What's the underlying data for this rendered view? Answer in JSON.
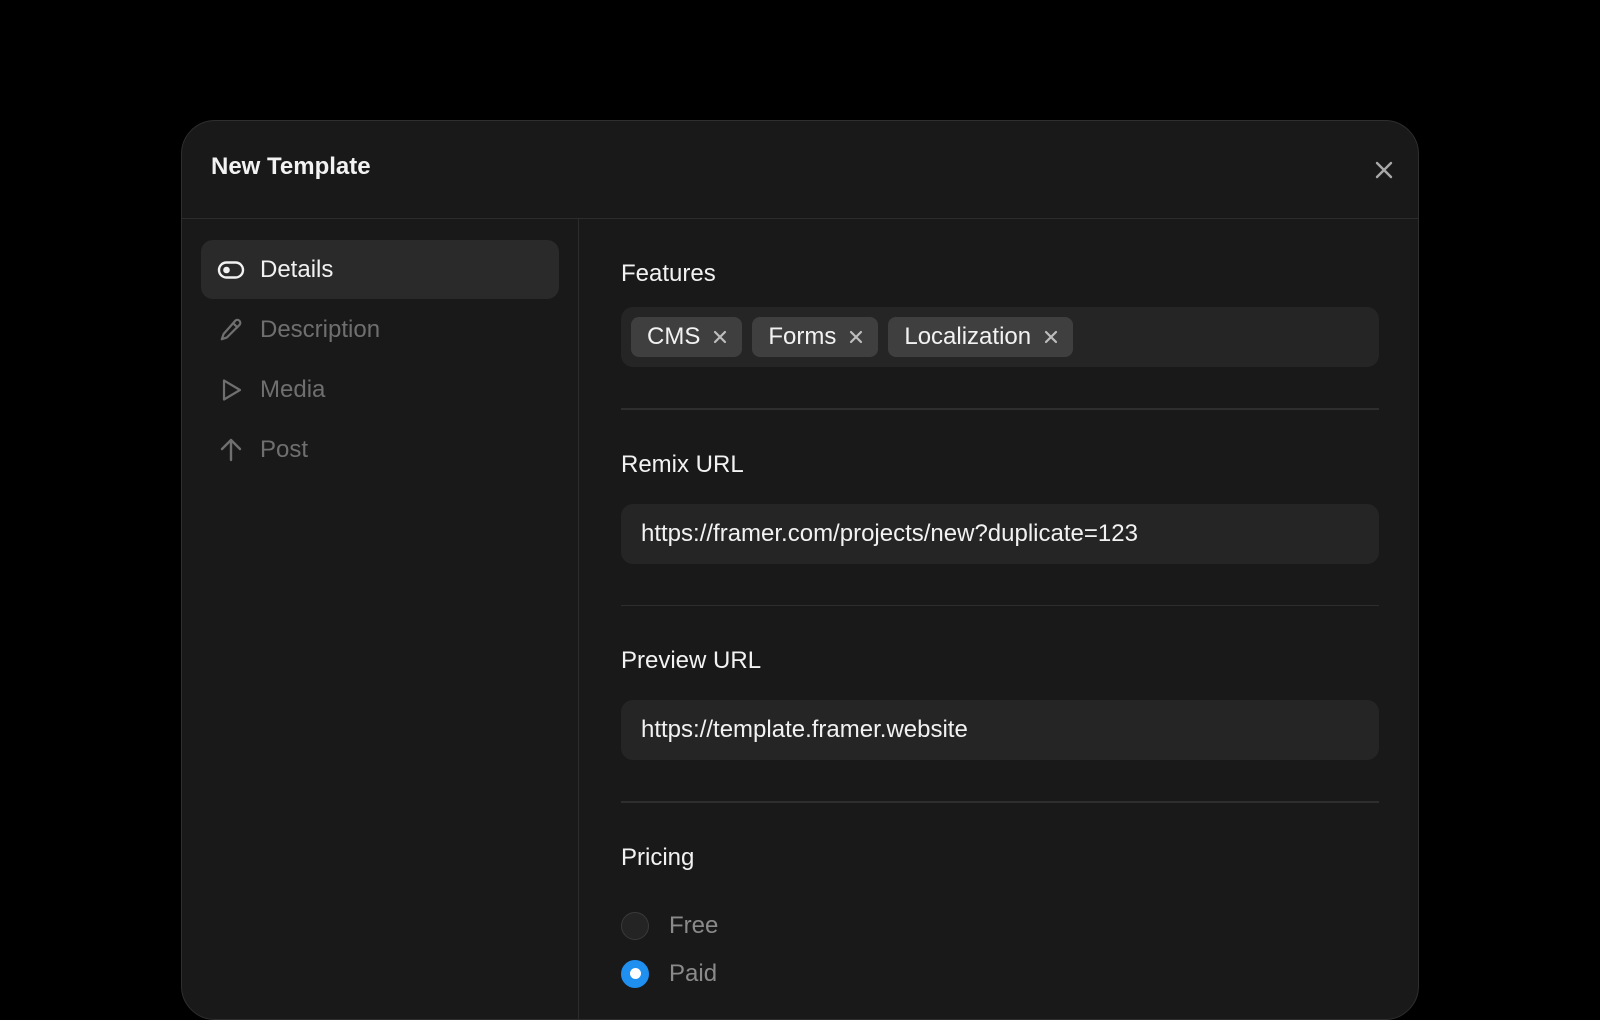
{
  "modal": {
    "title": "New Template",
    "close_icon": "close-icon"
  },
  "sidebar": {
    "items": [
      {
        "label": "Details",
        "icon": "toggle-icon",
        "active": true
      },
      {
        "label": "Description",
        "icon": "pencil-icon",
        "active": false
      },
      {
        "label": "Media",
        "icon": "play-icon",
        "active": false
      },
      {
        "label": "Post",
        "icon": "arrow-up-icon",
        "active": false
      }
    ]
  },
  "features": {
    "label": "Features",
    "tags": [
      "CMS",
      "Forms",
      "Localization"
    ]
  },
  "remix_url": {
    "label": "Remix URL",
    "value": "https://framer.com/projects/new?duplicate=123"
  },
  "preview_url": {
    "label": "Preview URL",
    "value": "https://template.framer.website"
  },
  "pricing": {
    "label": "Pricing",
    "options": [
      {
        "label": "Free",
        "selected": false
      },
      {
        "label": "Paid",
        "selected": true
      }
    ]
  },
  "colors": {
    "accent": "#1f8ff0",
    "modal_bg": "#191919",
    "field_bg": "#252525",
    "tag_bg": "#3f3f3f"
  }
}
